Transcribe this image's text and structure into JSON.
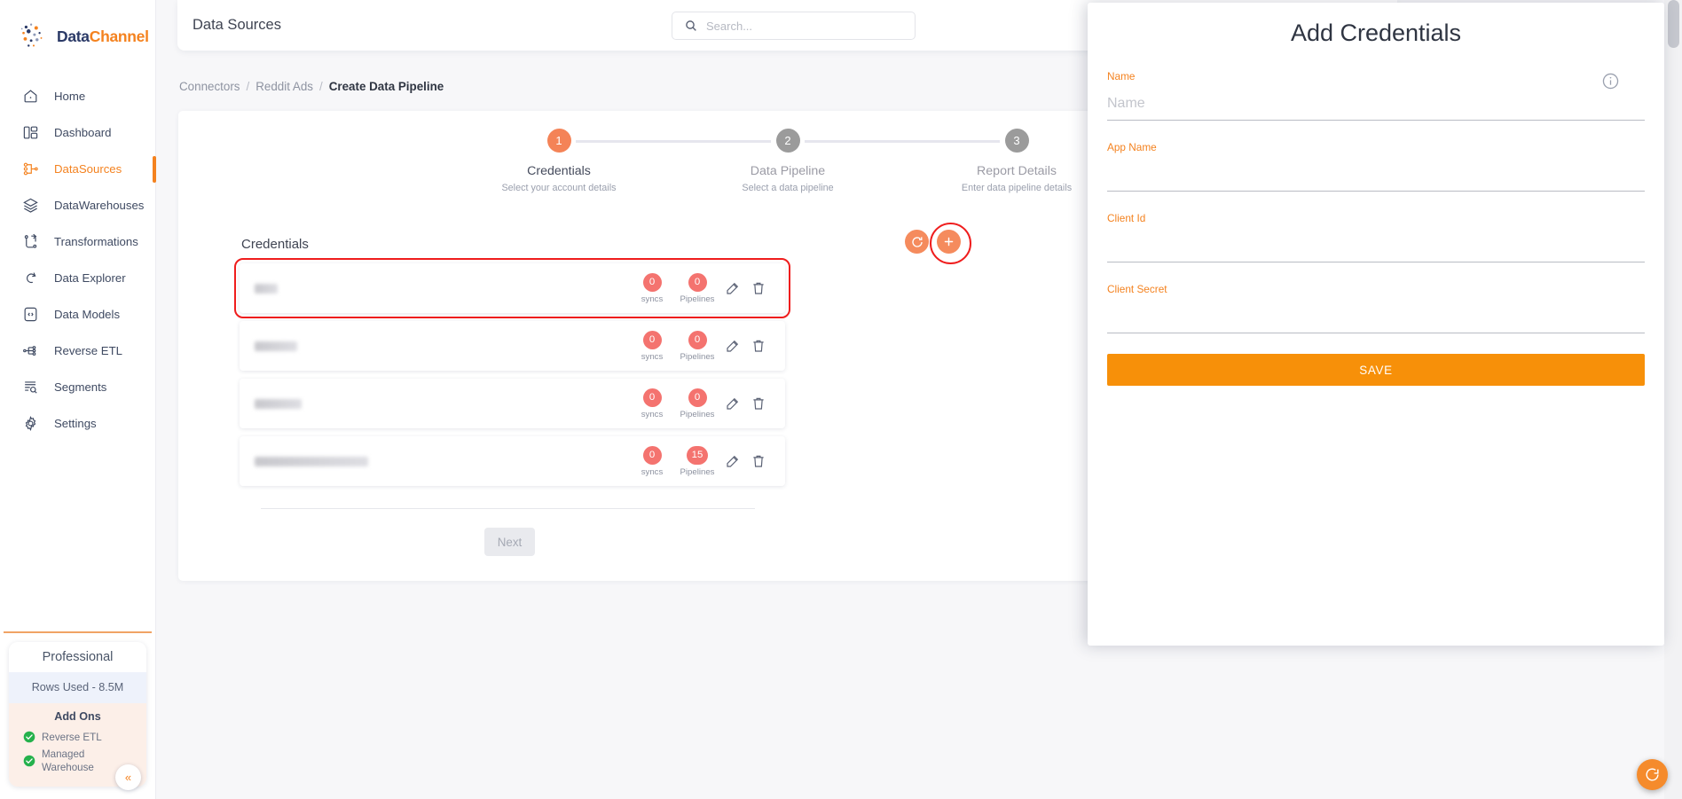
{
  "brand": {
    "first": "Data",
    "second": "Channel"
  },
  "sidebar": {
    "items": [
      {
        "label": "Home",
        "icon": "home-icon"
      },
      {
        "label": "Dashboard",
        "icon": "dashboard-icon"
      },
      {
        "label": "DataSources",
        "icon": "datasources-icon"
      },
      {
        "label": "DataWarehouses",
        "icon": "datawarehouses-icon"
      },
      {
        "label": "Transformations",
        "icon": "transformations-icon"
      },
      {
        "label": "Data Explorer",
        "icon": "data-explorer-icon"
      },
      {
        "label": "Data Models",
        "icon": "data-models-icon"
      },
      {
        "label": "Reverse ETL",
        "icon": "reverse-etl-icon"
      },
      {
        "label": "Segments",
        "icon": "segments-icon"
      },
      {
        "label": "Settings",
        "icon": "settings-icon"
      }
    ],
    "active_index": 2,
    "plan": {
      "name": "Professional",
      "rows_used": "Rows Used - 8.5M",
      "addons_title": "Add Ons",
      "addons": [
        "Reverse ETL",
        "Managed Warehouse"
      ]
    },
    "collapse_label": "«"
  },
  "topbar": {
    "title": "Data Sources",
    "search": {
      "placeholder": "Search...",
      "value": "",
      "icon": "search-icon"
    }
  },
  "breadcrumb": {
    "items": [
      "Connectors",
      "Reddit Ads",
      "Create Data Pipeline"
    ],
    "separator": "/"
  },
  "stepper": {
    "steps": [
      {
        "number": "1",
        "label": "Credentials",
        "sub": "Select your account details",
        "state": "active"
      },
      {
        "number": "2",
        "label": "Data Pipeline",
        "sub": "Select a data pipeline",
        "state": "inactive"
      },
      {
        "number": "3",
        "label": "Report Details",
        "sub": "Enter data pipeline details",
        "state": "inactive"
      }
    ]
  },
  "credentials": {
    "heading": "Credentials",
    "refresh_icon": "refresh-icon",
    "add_icon": "plus-icon",
    "rows": [
      {
        "name_width": 26,
        "syncs": "0",
        "syncs_label": "syncs",
        "pipelines": "0",
        "pipelines_label": "Pipelines",
        "selected": true
      },
      {
        "name_width": 48,
        "syncs": "0",
        "syncs_label": "syncs",
        "pipelines": "0",
        "pipelines_label": "Pipelines",
        "selected": false
      },
      {
        "name_width": 53,
        "syncs": "0",
        "syncs_label": "syncs",
        "pipelines": "0",
        "pipelines_label": "Pipelines",
        "selected": false
      },
      {
        "name_width": 128,
        "syncs": "0",
        "syncs_label": "syncs",
        "pipelines": "15",
        "pipelines_label": "Pipelines",
        "selected": false
      }
    ],
    "edit_icon": "edit-icon",
    "delete_icon": "trash-icon",
    "next_label": "Next"
  },
  "panel": {
    "title": "Add Credentials",
    "info_icon": "info-icon",
    "fields": [
      {
        "label": "Name",
        "placeholder": "Name",
        "value": ""
      },
      {
        "label": "App Name",
        "placeholder": "",
        "value": ""
      },
      {
        "label": "Client Id",
        "placeholder": "",
        "value": ""
      },
      {
        "label": "Client Secret",
        "placeholder": "",
        "value": ""
      }
    ],
    "save_label": "SAVE"
  },
  "colors": {
    "accent_orange": "#f4821f",
    "step_active": "#f48357",
    "badge_red": "#f4736f",
    "highlight_red": "#ef1d1d",
    "save_orange": "#f79009",
    "brand_navy": "#2b3a67"
  }
}
